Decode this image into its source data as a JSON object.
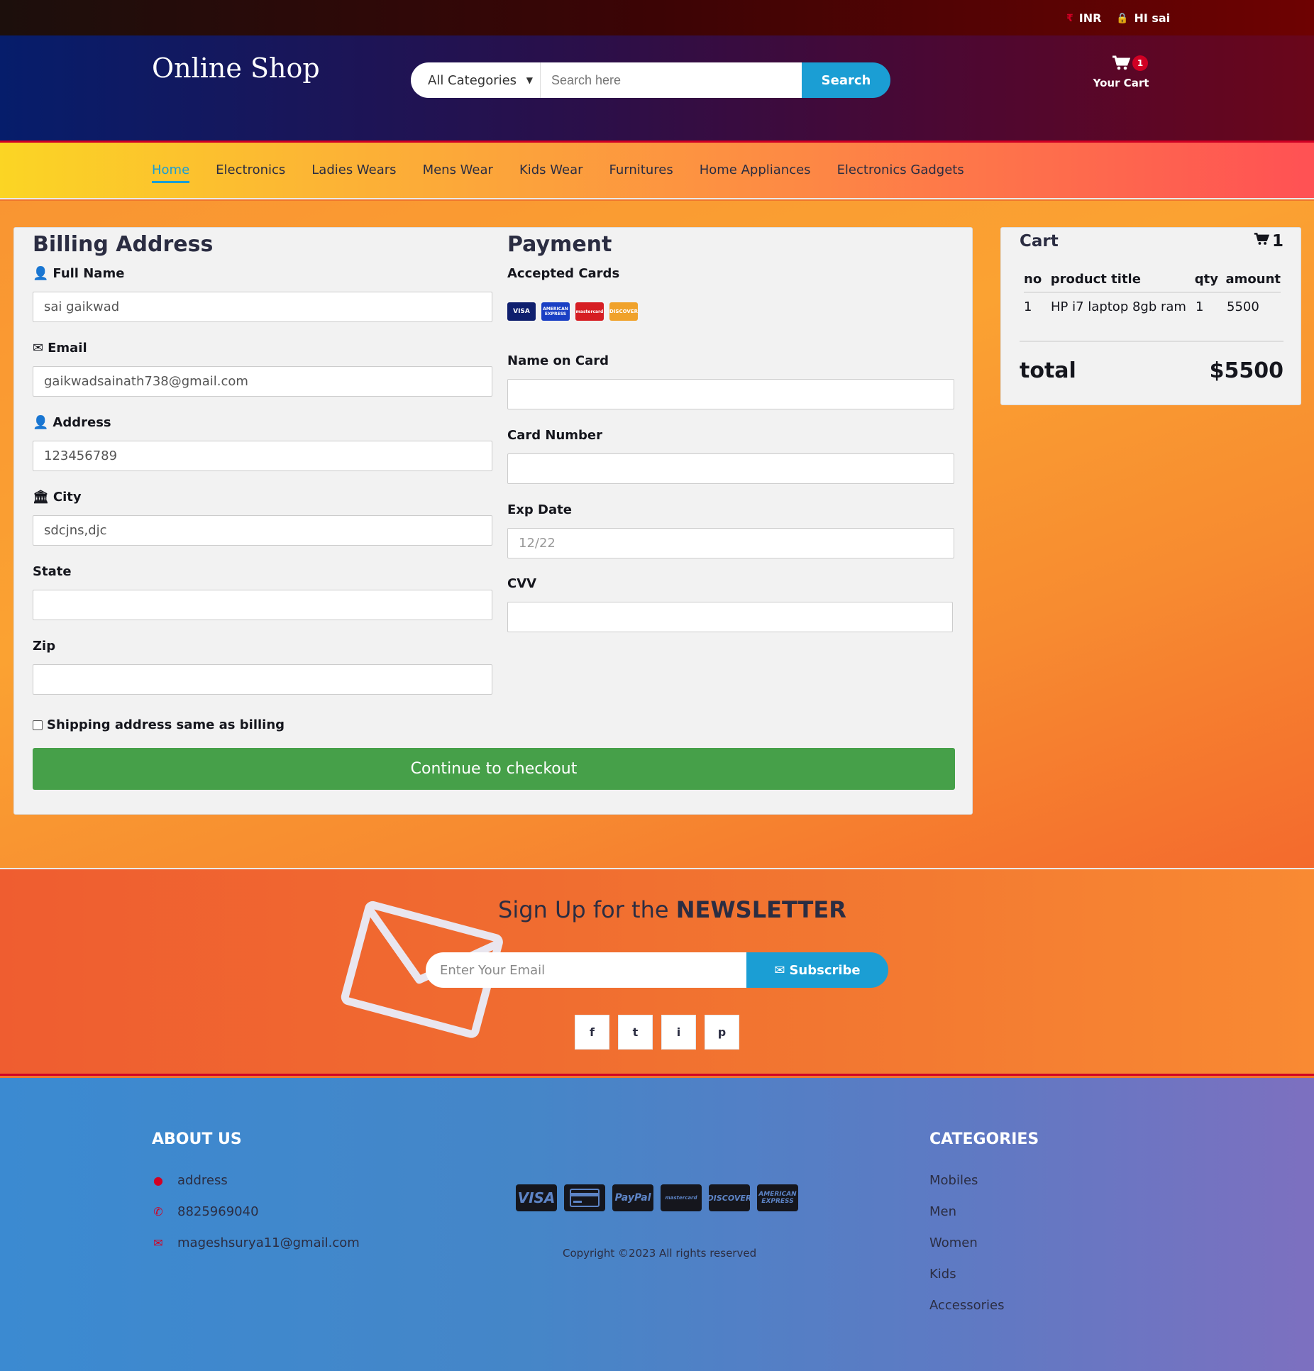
{
  "topbar": {
    "currency": "INR",
    "user": "HI sai"
  },
  "header": {
    "logo": "Online Shop",
    "category_select": "All Categories",
    "search_placeholder": "Search here",
    "search_button": "Search",
    "cart_badge": "1",
    "cart_label": "Your Cart"
  },
  "nav": {
    "items": [
      "Home",
      "Electronics",
      "Ladies Wears",
      "Mens Wear",
      "Kids Wear",
      "Furnitures",
      "Home Appliances",
      "Electronics Gadgets"
    ]
  },
  "billing": {
    "title": "Billing Address",
    "full_name_label": "Full Name",
    "full_name_value": "sai gaikwad",
    "email_label": "Email",
    "email_value": "gaikwadsainath738@gmail.com",
    "address_label": "Address",
    "address_value": "123456789",
    "city_label": "City",
    "city_value": "sdcjns,djc",
    "state_label": "State",
    "zip_label": "Zip",
    "shipping_same": "Shipping address same as billing"
  },
  "payment": {
    "title": "Payment",
    "accepted_label": "Accepted Cards",
    "cards": [
      "VISA",
      "AMERICAN EXPRESS",
      "mastercard",
      "DISCOVER"
    ],
    "name_label": "Name on Card",
    "number_label": "Card Number",
    "exp_label": "Exp Date",
    "exp_placeholder": "12/22",
    "cvv_label": "CVV"
  },
  "checkout_button": "Continue to checkout",
  "cart": {
    "title": "Cart",
    "count": "1",
    "columns": [
      "no",
      "product title",
      "qty",
      "amount"
    ],
    "rows": [
      {
        "no": "1",
        "title": "HP i7 laptop 8gb ram",
        "qty": "1",
        "amount": "5500"
      }
    ],
    "total_label": "total",
    "total_value": "$5500"
  },
  "newsletter": {
    "title_prefix": "Sign Up for the ",
    "title_bold": "NEWSLETTER",
    "email_placeholder": "Enter Your Email",
    "subscribe": "Subscribe",
    "social": [
      "f",
      "t",
      "i",
      "p"
    ]
  },
  "footer": {
    "about_title": "ABOUT US",
    "about_items": [
      "address",
      "8825969040",
      "mageshsurya11@gmail.com"
    ],
    "categories_title": "CATEGORIES",
    "categories": [
      "Mobiles",
      "Men",
      "Women",
      "Kids",
      "Accessories"
    ],
    "payment_icons": [
      "VISA",
      "card",
      "PayPal",
      "mastercard",
      "DISCOVER",
      "AMERICAN EXPRESS"
    ],
    "copyright": "Copyright ©2023 All rights reserved"
  },
  "colors": {
    "accent": "#d10024",
    "primary": "#1b9ed4",
    "checkout": "#46a049"
  }
}
